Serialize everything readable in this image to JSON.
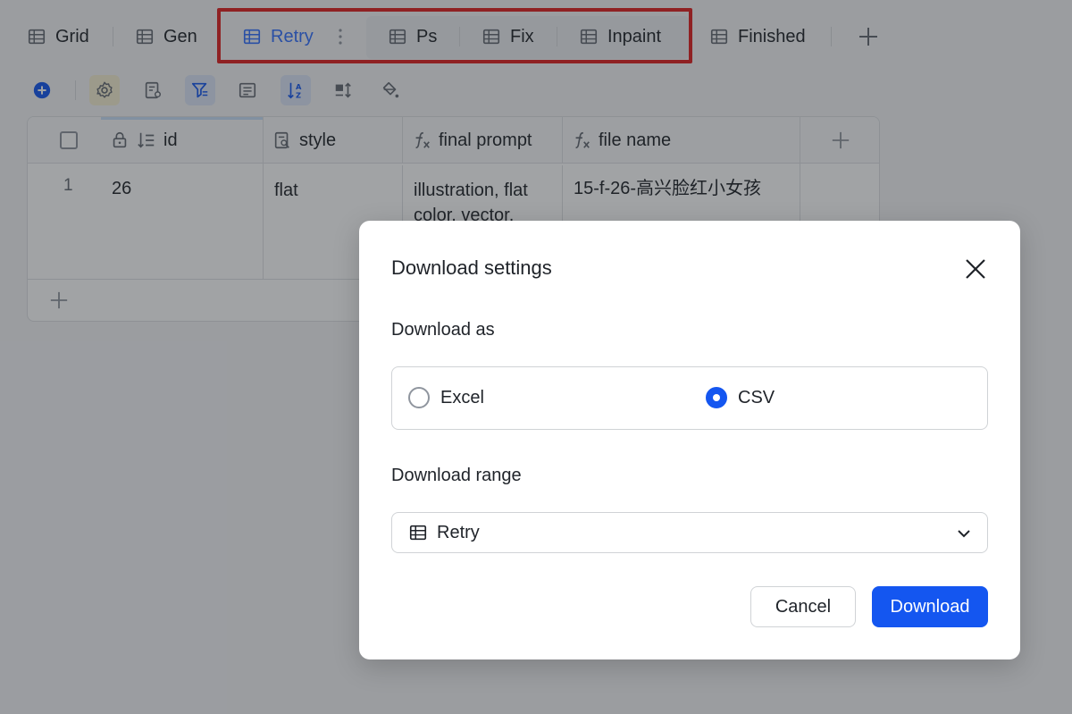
{
  "tabs": [
    {
      "label": "Grid",
      "icon": "grid-table-icon"
    },
    {
      "label": "Gen",
      "icon": "grid-table-icon"
    },
    {
      "label": "Retry",
      "icon": "grid-table-icon",
      "active": true
    },
    {
      "label": "Ps",
      "icon": "grid-table-icon"
    },
    {
      "label": "Fix",
      "icon": "grid-table-icon"
    },
    {
      "label": "Inpaint",
      "icon": "grid-table-icon"
    },
    {
      "label": "Finished",
      "icon": "grid-table-icon"
    }
  ],
  "toolbar": {
    "icons": [
      "add-record-icon",
      "settings-icon",
      "form-icon",
      "filter-icon",
      "group-icon",
      "sort-icon",
      "row-height-icon",
      "fill-color-icon"
    ]
  },
  "grid": {
    "columns": [
      {
        "label": "id",
        "icon": "autonumber-icon"
      },
      {
        "label": "style",
        "icon": "lookup-icon"
      },
      {
        "label": "final prompt",
        "icon": "formula-icon"
      },
      {
        "label": "file name",
        "icon": "formula-icon"
      }
    ],
    "rows": [
      {
        "num": "1",
        "id": "26",
        "style": "flat",
        "final_prompt": "illustration, flat color, vector,",
        "file_name": "15-f-26-高兴脸红小女孩"
      }
    ]
  },
  "dialog": {
    "title": "Download settings",
    "download_as_label": "Download as",
    "options": [
      {
        "label": "Excel",
        "checked": false
      },
      {
        "label": "CSV",
        "checked": true
      }
    ],
    "range_label": "Download range",
    "range_value": "Retry",
    "cancel_label": "Cancel",
    "download_label": "Download"
  },
  "colors": {
    "accent": "#1456f0",
    "highlight": "#e02020"
  }
}
